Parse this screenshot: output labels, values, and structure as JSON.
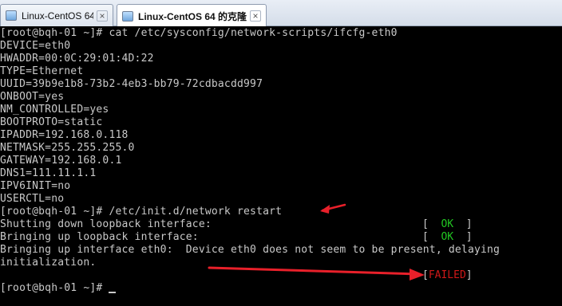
{
  "tabs": [
    {
      "label": "Linux-CentOS 64",
      "active": false
    },
    {
      "label": "Linux-CentOS 64 的克隆",
      "active": true
    }
  ],
  "terminal": {
    "lines": [
      "[root@bqh-01 ~]# cat /etc/sysconfig/network-scripts/ifcfg-eth0",
      "DEVICE=eth0",
      "HWADDR=00:0C:29:01:4D:22",
      "TYPE=Ethernet",
      "UUID=39b9e1b8-73b2-4eb3-bb79-72cdbacdd997",
      "ONBOOT=yes",
      "NM_CONTROLLED=yes",
      "BOOTPROTO=static",
      "IPADDR=192.168.0.118",
      "NETMASK=255.255.255.0",
      "GATEWAY=192.168.0.1",
      "DNS1=111.11.1.1",
      "IPV6INIT=no",
      "USERCTL=no",
      "[root@bqh-01 ~]# /etc/init.d/network restart",
      "Shutting down loopback interface:",
      "Bringing up loopback interface:",
      "Bringing up interface eth0:  Device eth0 does not seem to be present, delaying",
      "initialization.",
      "",
      "[root@bqh-01 ~]# "
    ],
    "status_ok": "OK",
    "status_failed": "FAILED",
    "annotation_color": "#e8202a"
  }
}
